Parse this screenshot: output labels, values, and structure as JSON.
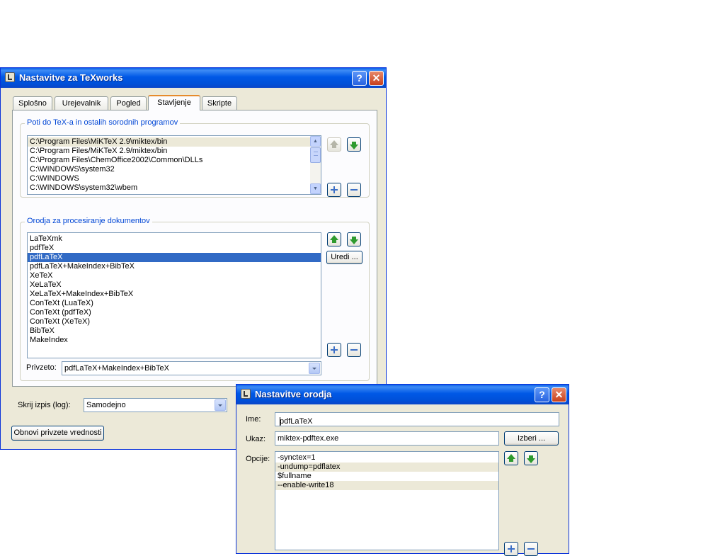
{
  "prefs": {
    "title": "Nastavitve za TeXworks",
    "tabs": [
      {
        "label": "Splošno"
      },
      {
        "label": "Urejevalnik"
      },
      {
        "label": "Pogled"
      },
      {
        "label": "Stavljenje"
      },
      {
        "label": "Skripte"
      }
    ],
    "active_tab": "Stavljenje",
    "paths_group": {
      "title": "Poti do TeX-a in ostalih sorodnih programov",
      "items": [
        "C:\\Program Files\\MiKTeX 2.9\\miktex/bin",
        "C:\\Program Files/MiKTeX 2.9/miktex/bin",
        "C:\\Program Files\\ChemOffice2002\\Common\\DLLs",
        "C:\\WINDOWS\\system32",
        "C:\\WINDOWS",
        "C:\\WINDOWS\\system32\\wbem"
      ]
    },
    "tools_group": {
      "title": "Orodja za procesiranje dokumentov",
      "items": [
        "LaTeXmk",
        "pdfTeX",
        "pdfLaTeX",
        "pdfLaTeX+MakeIndex+BibTeX",
        "XeTeX",
        "XeLaTeX",
        "XeLaTeX+MakeIndex+BibTeX",
        "ConTeXt (LuaTeX)",
        "ConTeXt (pdfTeX)",
        "ConTeXt (XeTeX)",
        "BibTeX",
        "MakeIndex"
      ],
      "selected": "pdfLaTeX",
      "edit_label": "Uredi ...",
      "default_label": "Privzeto:",
      "default_value": "pdfLaTeX+MakeIndex+BibTeX"
    },
    "log_label": "Skrij izpis (log):",
    "log_value": "Samodejno",
    "restore_label": "Obnovi privzete vrednosti"
  },
  "tool": {
    "title": "Nastavitve orodja",
    "name_label": "Ime:",
    "name_value": "pdfLaTeX",
    "cmd_label": "Ukaz:",
    "cmd_value": "miktex-pdftex.exe",
    "browse_label": "Izberi ...",
    "options_label": "Opcije:",
    "options": [
      "-synctex=1",
      "-undump=pdflatex",
      "$fullname",
      "--enable-write18"
    ]
  },
  "titlebar": {
    "help": "?",
    "close": "✕"
  },
  "colors": {
    "titlebar": "#0058e6",
    "window": "#ece9d8",
    "selection": "#316ac5",
    "accent_arrow": "#2e9a2e",
    "tab_highlight": "#e68b2c"
  }
}
